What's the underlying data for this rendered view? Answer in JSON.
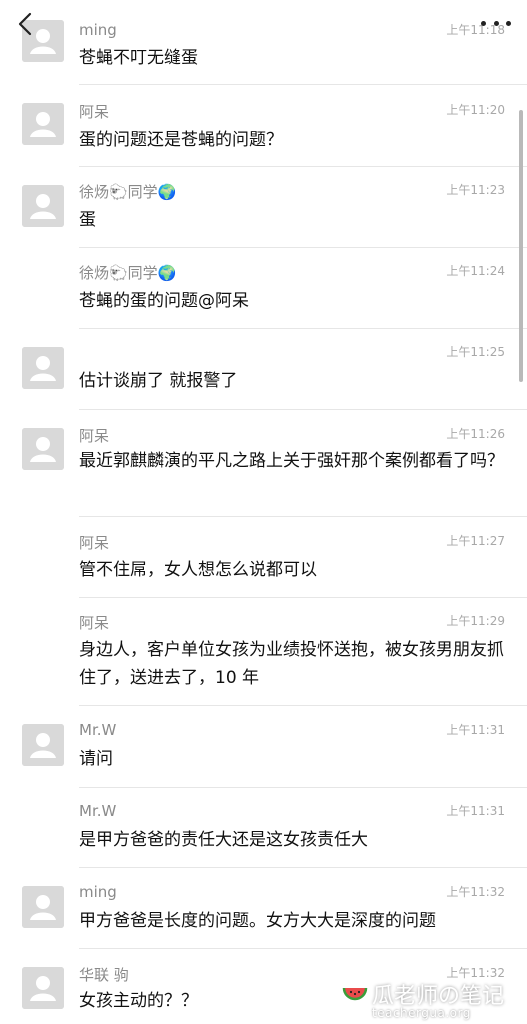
{
  "header": {
    "back_icon": "chevron-left-icon",
    "more_icon": "more-dots-icon"
  },
  "messages": [
    {
      "name": "ming",
      "time": "上午11:18",
      "text": "苍蝇不叮无缝蛋",
      "avatar": true
    },
    {
      "name": "阿呆",
      "time": "上午11:20",
      "text": "蛋的问题还是苍蝇的问题？",
      "avatar": true
    },
    {
      "name": "徐炀🐑同学🌍",
      "time": "上午11:23",
      "text": "蛋",
      "avatar": true
    },
    {
      "name": "徐炀🐑同学🌍",
      "time": "上午11:24",
      "text": "苍蝇的蛋的问题@阿呆",
      "avatar": false
    },
    {
      "name": "",
      "time": "上午11:25",
      "text": "估计谈崩了 就报警了",
      "avatar": true
    },
    {
      "name": "阿呆",
      "time": "上午11:26",
      "text": "最近郭麒麟演的平凡之路上关于强奸那个案例都看了吗？",
      "avatar": true
    },
    {
      "name": "阿呆",
      "time": "上午11:27",
      "text": "管不住屌，女人想怎么说都可以",
      "avatar": false
    },
    {
      "name": "阿呆",
      "time": "上午11:29",
      "text": "身边人，客户单位女孩为业绩投怀送抱，被女孩男朋友抓住了，送进去了，10 年",
      "avatar": false
    },
    {
      "name": "Mr.W",
      "time": "上午11:31",
      "text": "请问",
      "avatar": true
    },
    {
      "name": "Mr.W",
      "time": "上午11:31",
      "text": "是甲方爸爸的责任大还是这女孩责任大",
      "avatar": false
    },
    {
      "name": "ming",
      "time": "上午11:32",
      "text": "甲方爸爸是长度的问题。女方大大是深度的问题",
      "avatar": true
    },
    {
      "name": "华联 驹",
      "time": "上午11:32",
      "text": "女孩主动的？？",
      "avatar": true
    }
  ],
  "watermark": {
    "title": "瓜老师の笔记",
    "url": "teachergua.org"
  }
}
